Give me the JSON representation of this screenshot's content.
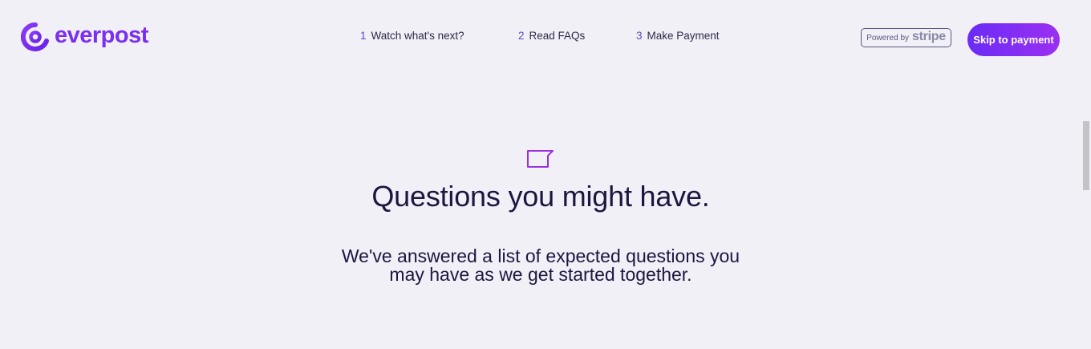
{
  "brand": {
    "name": "everpost",
    "color": "#7a2ff0",
    "logo_icon": "at-sign-logo-icon"
  },
  "nav": {
    "steps": [
      {
        "number": "1",
        "label": "Watch what's next?"
      },
      {
        "number": "2",
        "label": "Read FAQs"
      },
      {
        "number": "3",
        "label": "Make Payment"
      }
    ]
  },
  "stripe_badge": {
    "prefix": "Powered by",
    "brand": "stripe"
  },
  "skip_button": {
    "label": "Skip to payment",
    "gradient": [
      "#6a2cf5",
      "#9b2ff2"
    ]
  },
  "faq_section": {
    "icon": "chat-bubble-icon",
    "title": "Questions you might have.",
    "subtitle_line1": "We've answered a list of expected questions you",
    "subtitle_line2": "may have as we get started together."
  },
  "colors": {
    "background": "#f1f0f6",
    "text": "#1e1640",
    "accent": "#7a2ff0"
  }
}
